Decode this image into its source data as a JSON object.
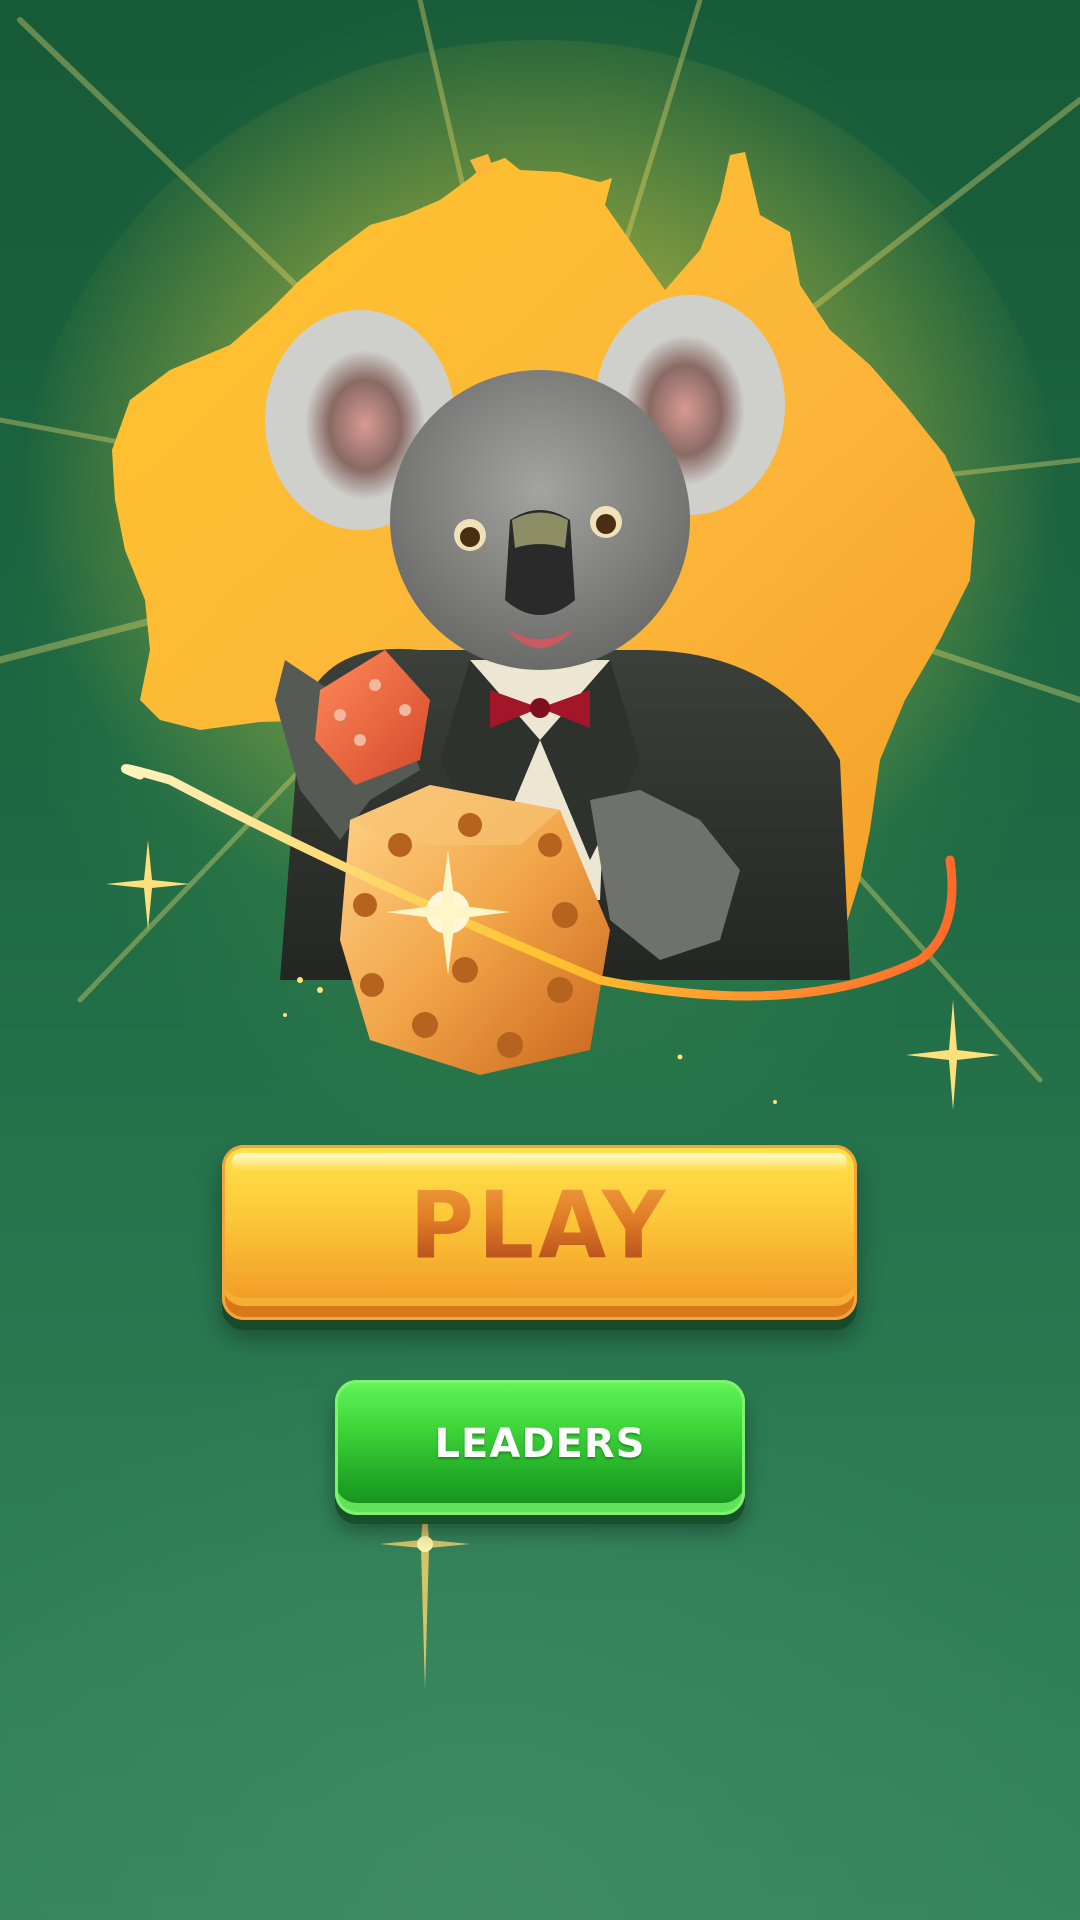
{
  "menu": {
    "play_label": "PLAY",
    "leaders_label": "LEADERS"
  },
  "artwork": {
    "map_icon": "australia-map-icon",
    "mascot_icon": "koala-mascot-icon",
    "dice_icon": "dice-icon",
    "sparkle_icon": "sparkle-icon"
  },
  "colors": {
    "background": "#1f6a44",
    "map": "#fbb838",
    "play_button": "#fcc93a",
    "play_text": "#c4501c",
    "leaders_button": "#3fd63a",
    "leaders_text": "#ffffff"
  }
}
